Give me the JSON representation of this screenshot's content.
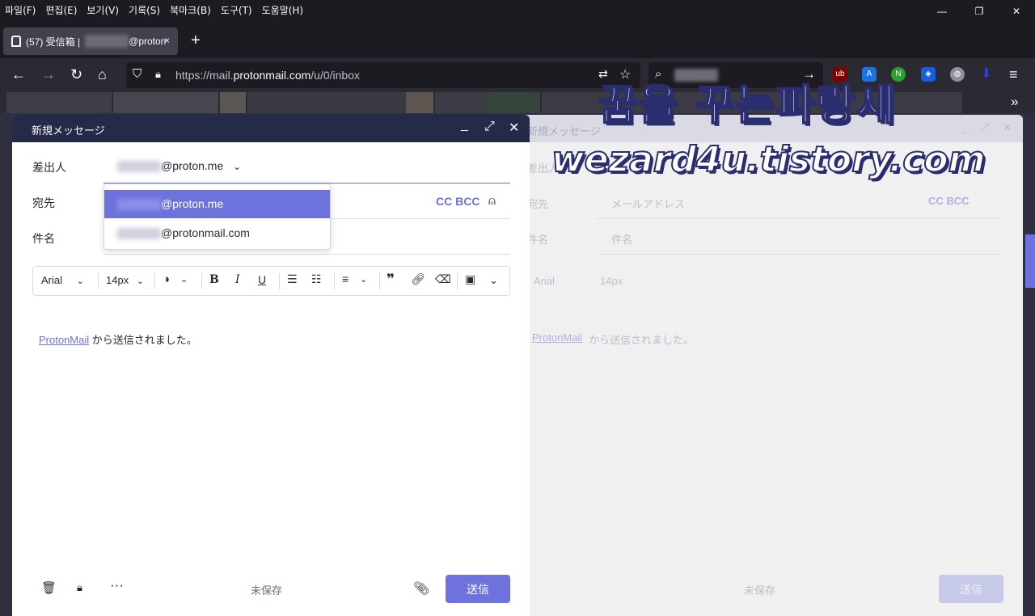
{
  "browser": {
    "menu": [
      "파일(F)",
      "편집(E)",
      "보기(V)",
      "기록(S)",
      "북마크(B)",
      "도구(T)",
      "도움말(H)"
    ],
    "window_controls": [
      "—",
      "❐",
      "✕"
    ],
    "tab": {
      "count_label": "(57) 受信箱 |",
      "email_suffix": "@proton",
      "close": "×"
    },
    "new_tab": "+",
    "url": {
      "prefix": "https://mail.",
      "domain": "protonmail.com",
      "path": "/u/0/inbox"
    }
  },
  "watermark": {
    "line1": "꿈을 꾸는파랑새",
    "line2": "wezard4u.tistory.com"
  },
  "composer": {
    "title": "新規メッセージ",
    "from_label": "差出人",
    "from_value_suffix": "@proton.me",
    "to_label": "宛先",
    "subject_label": "件名",
    "cc_bcc": "CC BCC",
    "dropdown": {
      "options": [
        {
          "suffix": "@proton.me",
          "selected": true
        },
        {
          "suffix": "@protonmail.com",
          "selected": false
        }
      ]
    },
    "toolbar": {
      "font": "Arial",
      "size": "14px"
    },
    "body": {
      "link": "ProtonMail",
      "rest": " から送信されました。"
    },
    "footer": {
      "status": "未保存",
      "send": "送信"
    }
  },
  "ghost_composer": {
    "title": "新規メッセージ",
    "from_label": "差出人",
    "to_label": "宛先",
    "to_placeholder": "メールアドレス",
    "subject_label": "件名",
    "subject_placeholder": "件名",
    "cc_bcc": "CC BCC",
    "font": "Arial",
    "size": "14px",
    "body_link": "ProtonMail",
    "body_rest": " から送信されました。",
    "status": "未保存",
    "send": "送信"
  },
  "colors": {
    "accent": "#6d72dc",
    "header": "#262a49",
    "browser_bg": "#1c1b22"
  }
}
